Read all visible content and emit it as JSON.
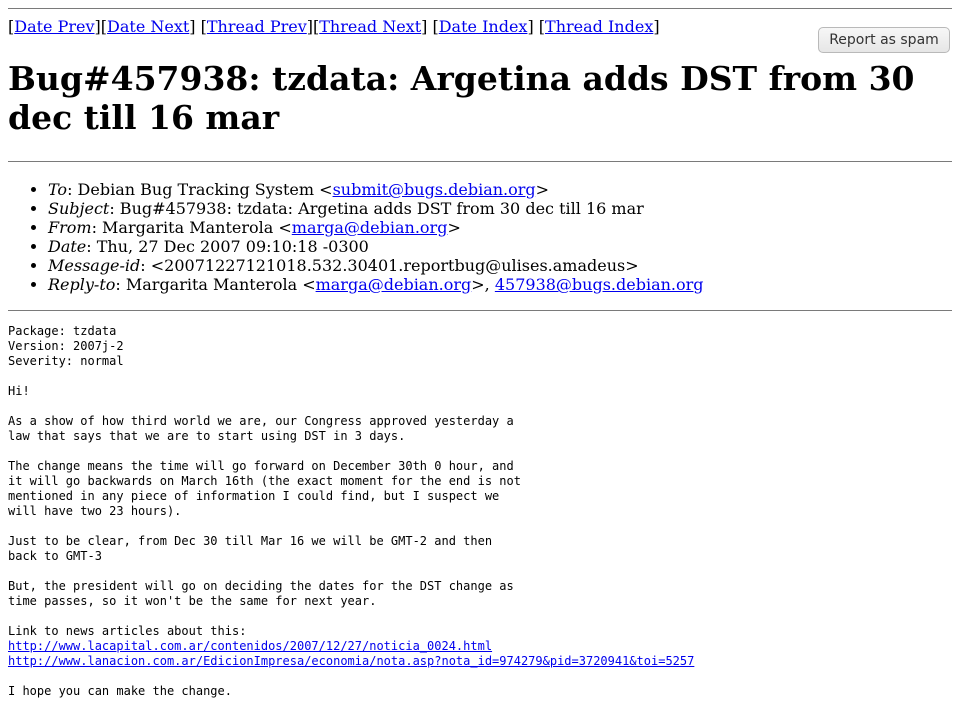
{
  "nav": {
    "date_prev": "Date Prev",
    "date_next": "Date Next",
    "thread_prev": "Thread Prev",
    "thread_next": "Thread Next",
    "date_index": "Date Index",
    "thread_index": "Thread Index"
  },
  "spam_button": "Report as spam",
  "title": "Bug#457938: tzdata: Argetina adds DST from 30 dec till 16 mar",
  "headers": {
    "to": {
      "key": "To",
      "prefix": ": Debian Bug Tracking System <",
      "link": "submit@bugs.debian.org",
      "suffix": ">"
    },
    "subject": {
      "key": "Subject",
      "value": ": Bug#457938: tzdata: Argetina adds DST from 30 dec till 16 mar"
    },
    "from": {
      "key": "From",
      "prefix": ": Margarita Manterola <",
      "link": "marga@debian.org",
      "suffix": ">"
    },
    "date": {
      "key": "Date",
      "value": ": Thu, 27 Dec 2007 09:10:18 -0300"
    },
    "message_id": {
      "key": "Message-id",
      "value": ": <20071227121018.532.30401.reportbug@ulises.amadeus>"
    },
    "reply_to": {
      "key": "Reply-to",
      "prefix": ": Margarita Manterola <",
      "link1": "marga@debian.org",
      "middle": ">, ",
      "link2": "457938@bugs.debian.org"
    }
  },
  "body": {
    "text": "Package: tzdata\nVersion: 2007j-2\nSeverity: normal\n\nHi!\n\nAs a show of how third world we are, our Congress approved yesterday a\nlaw that says that we are to start using DST in 3 days.\n\nThe change means the time will go forward on December 30th 0 hour, and\nit will go backwards on March 16th (the exact moment for the end is not\nmentioned in any piece of information I could find, but I suspect we\nwill have two 23 hours).\n\nJust to be clear, from Dec 30 till Mar 16 we will be GMT-2 and then\nback to GMT-3\n\nBut, the president will go on deciding the dates for the DST change as\ntime passes, so it won't be the same for next year.\n\nLink to news articles about this:\n",
    "link1": "http://www.lacapital.com.ar/contenidos/2007/12/27/noticia_0024.html",
    "link2": "http://www.lanacion.com.ar/EdicionImpresa/economia/nota.asp?nota_id=974279&pid=3720941&toi=5257",
    "closing": "\n\nI hope you can make the change."
  }
}
